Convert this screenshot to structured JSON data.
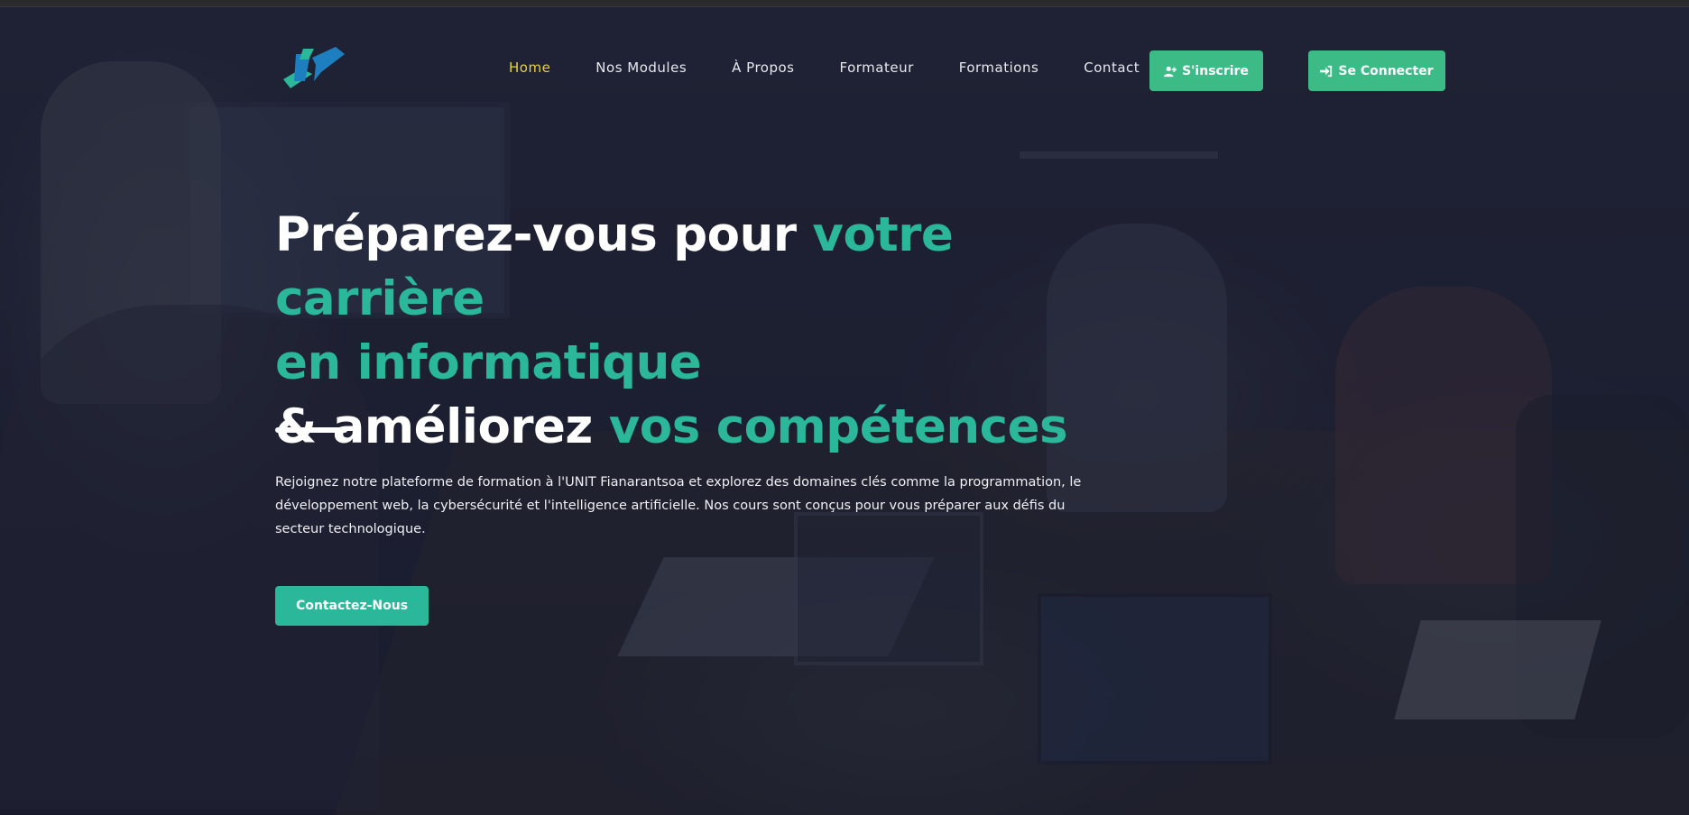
{
  "nav": {
    "links": [
      {
        "label": "Home",
        "active": true
      },
      {
        "label": "Nos Modules",
        "active": false
      },
      {
        "label": "À Propos",
        "active": false
      },
      {
        "label": "Formateur",
        "active": false
      },
      {
        "label": "Formations",
        "active": false
      },
      {
        "label": "Contact",
        "active": false
      }
    ],
    "signup_label": "S'inscrire",
    "login_label": "Se Connecter"
  },
  "hero": {
    "line1_white": "Préparez-vous pour ",
    "line1_accent": "votre carrière",
    "line2_accent": "en informatique",
    "line3_white": "& améliorez ",
    "line3_accent": "vos compétences",
    "description": "Rejoignez notre plateforme de formation à l'UNIT Fianarantsoa et explorez des domaines clés comme la programmation, le développement web, la cybersécurité et l'intelligence artificielle. Nos cours sont conçus pour vous préparer aux défis du secteur technologique.",
    "cta_label": "Contactez-Nous"
  },
  "colors": {
    "accent": "#2bb79a",
    "button_green": "#3dbb87",
    "active_link": "#e8d23a"
  },
  "icons": {
    "signup": "user-plus-icon",
    "login": "sign-in-icon",
    "logo": "brand-logo"
  }
}
